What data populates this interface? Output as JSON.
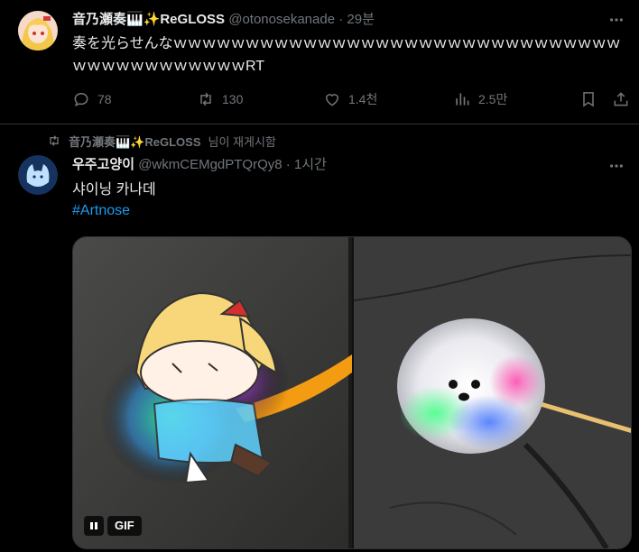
{
  "tweet1": {
    "author_name": "音乃瀬奏🎹✨ReGLOSS",
    "handle": "@otonosekanade",
    "time": "29분",
    "text": "奏を光らせんなｗｗｗｗｗｗｗｗｗｗｗｗｗｗｗｗｗｗｗｗｗｗｗｗｗｗｗｗｗｗｗｗｗｗｗｗｗｗｗｗｗｗｗRT",
    "actions": {
      "reply_count": "78",
      "retweet_count": "130",
      "like_count": "1.4천",
      "view_count": "2.5만"
    }
  },
  "tweet2": {
    "reposted_by": "音乃瀬奏🎹✨ReGLOSS",
    "reposted_suffix": "님이 재게시함",
    "author_name": "우주고양이",
    "handle": "@wkmCEMgdPTQrQy8",
    "time": "1시간",
    "text": "샤이닝 카나데",
    "hashtag": "#Artnose",
    "media": {
      "gif_label": "GIF"
    }
  },
  "icons": {
    "reply": "reply-icon",
    "retweet": "retweet-icon",
    "like": "heart-icon",
    "views": "views-chart-icon",
    "bookmark": "bookmark-icon",
    "share": "share-icon",
    "more": "more-dots-icon",
    "pause": "pause-icon"
  },
  "colors": {
    "background": "#000000",
    "text": "#e7e9ea",
    "muted": "#71767b",
    "link": "#1d9bf0",
    "border": "#2f3336"
  }
}
